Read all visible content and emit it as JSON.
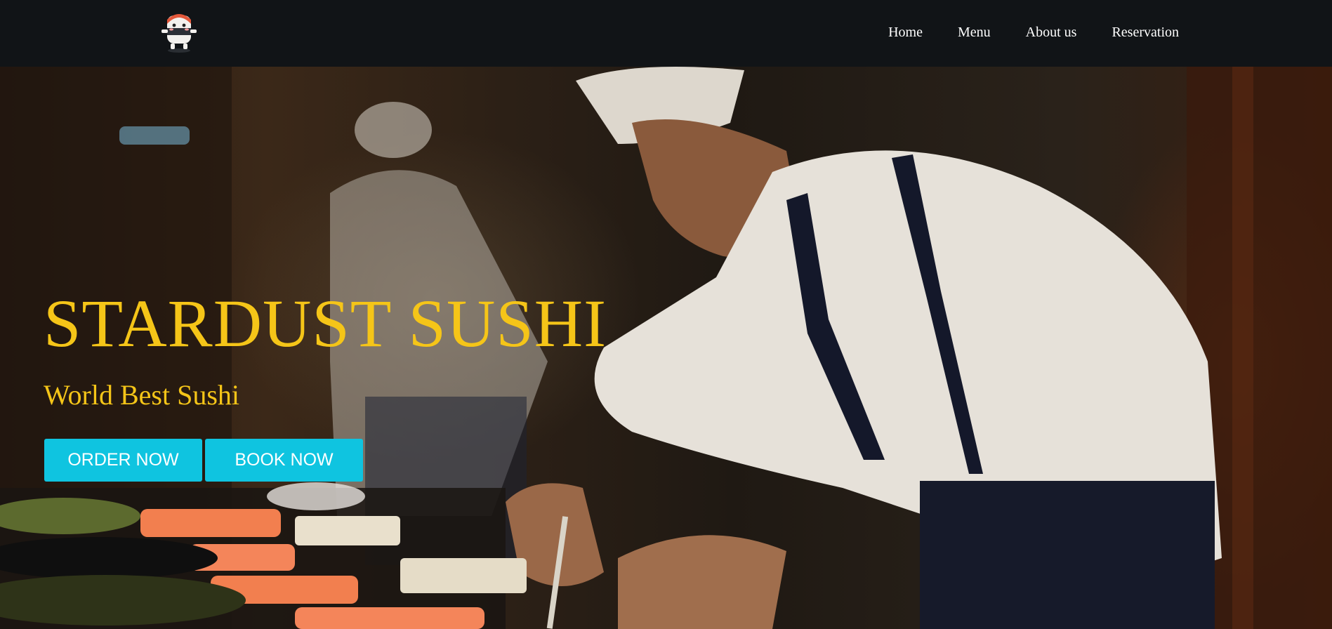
{
  "brand": {
    "logo_icon": "sushi-mascot-icon",
    "accent_color": "#f5c518",
    "button_color": "#0fc4e0"
  },
  "nav": {
    "items": [
      {
        "label": "Home"
      },
      {
        "label": "Menu"
      },
      {
        "label": "About us"
      },
      {
        "label": "Reservation"
      }
    ]
  },
  "hero": {
    "title": "STARDUST SUSHI",
    "subtitle": "World Best Sushi",
    "order_label": "ORDER NOW",
    "book_label": "BOOK NOW",
    "background_image": "sushi-chef-photo"
  }
}
